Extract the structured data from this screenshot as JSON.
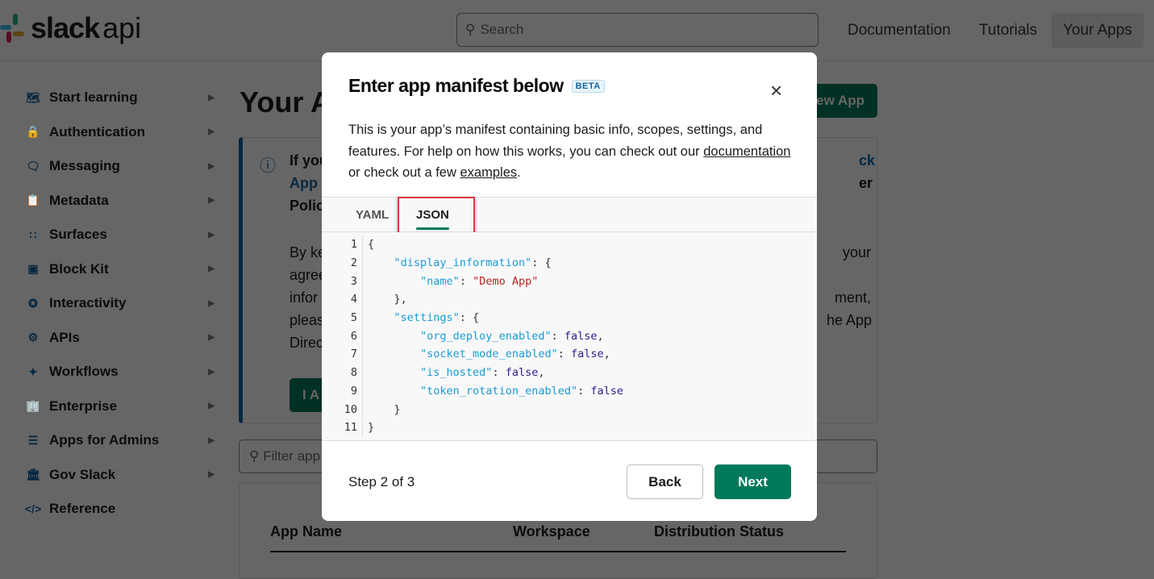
{
  "header": {
    "logo": {
      "word": "slack",
      "suffix": "api"
    },
    "search_placeholder": "Search",
    "nav": [
      "Documentation",
      "Tutorials",
      "Your Apps"
    ]
  },
  "sidebar": {
    "items": [
      {
        "label": "Start learning",
        "icon": "map-icon"
      },
      {
        "label": "Authentication",
        "icon": "lock-icon"
      },
      {
        "label": "Messaging",
        "icon": "message-icon"
      },
      {
        "label": "Metadata",
        "icon": "clipboard-icon"
      },
      {
        "label": "Surfaces",
        "icon": "grid-icon"
      },
      {
        "label": "Block Kit",
        "icon": "blocks-icon"
      },
      {
        "label": "Interactivity",
        "icon": "plug-icon"
      },
      {
        "label": "APIs",
        "icon": "gears-icon"
      },
      {
        "label": "Workflows",
        "icon": "wand-icon"
      },
      {
        "label": "Enterprise",
        "icon": "building-icon"
      },
      {
        "label": "Apps for Admins",
        "icon": "sliders-icon"
      },
      {
        "label": "Gov Slack",
        "icon": "bank-icon"
      },
      {
        "label": "Reference",
        "icon": "code-icon"
      }
    ]
  },
  "background": {
    "title": "Your A",
    "create_button": "ew App",
    "info_left": [
      "If you",
      "App",
      "Polic",
      "By ke",
      "agree",
      "infor",
      "pleas",
      "Direc"
    ],
    "info_right": [
      "ck",
      "er",
      "your",
      "ment,",
      "he App"
    ],
    "agree_button": "I A",
    "filter_placeholder": "Filter app",
    "table_headers": [
      "App Name",
      "Workspace",
      "Distribution Status"
    ]
  },
  "modal": {
    "title": "Enter app manifest below",
    "badge": "BETA",
    "desc_1": "This is your app’s manifest containing basic info, scopes, settings, and features. For help on how this works, you can check out our ",
    "link_docs": "documentation",
    "desc_2": " or check out a few ",
    "link_examples": "examples",
    "desc_3": ".",
    "tabs": [
      "YAML",
      "JSON"
    ],
    "active_tab": "JSON",
    "code": [
      [
        [
          "p",
          "{"
        ]
      ],
      [
        [
          "p",
          "    "
        ],
        [
          "k",
          "\"display_information\""
        ],
        [
          "p",
          ": {"
        ]
      ],
      [
        [
          "p",
          "        "
        ],
        [
          "k",
          "\"name\""
        ],
        [
          "p",
          ": "
        ],
        [
          "s",
          "\"Demo App\""
        ]
      ],
      [
        [
          "p",
          "    },"
        ]
      ],
      [
        [
          "p",
          "    "
        ],
        [
          "k",
          "\"settings\""
        ],
        [
          "p",
          ": {"
        ]
      ],
      [
        [
          "p",
          "        "
        ],
        [
          "k",
          "\"org_deploy_enabled\""
        ],
        [
          "p",
          ": "
        ],
        [
          "b",
          "false"
        ],
        [
          "p",
          ","
        ]
      ],
      [
        [
          "p",
          "        "
        ],
        [
          "k",
          "\"socket_mode_enabled\""
        ],
        [
          "p",
          ": "
        ],
        [
          "b",
          "false"
        ],
        [
          "p",
          ","
        ]
      ],
      [
        [
          "p",
          "        "
        ],
        [
          "k",
          "\"is_hosted\""
        ],
        [
          "p",
          ": "
        ],
        [
          "b",
          "false"
        ],
        [
          "p",
          ","
        ]
      ],
      [
        [
          "p",
          "        "
        ],
        [
          "k",
          "\"token_rotation_enabled\""
        ],
        [
          "p",
          ": "
        ],
        [
          "b",
          "false"
        ]
      ],
      [
        [
          "p",
          "    }"
        ]
      ],
      [
        [
          "p",
          "}"
        ]
      ]
    ],
    "step": "Step 2 of 3",
    "back": "Back",
    "next": "Next"
  },
  "colors": {
    "accent": "#007a5a",
    "link": "#1264a3",
    "highlight": "#e0393e"
  }
}
